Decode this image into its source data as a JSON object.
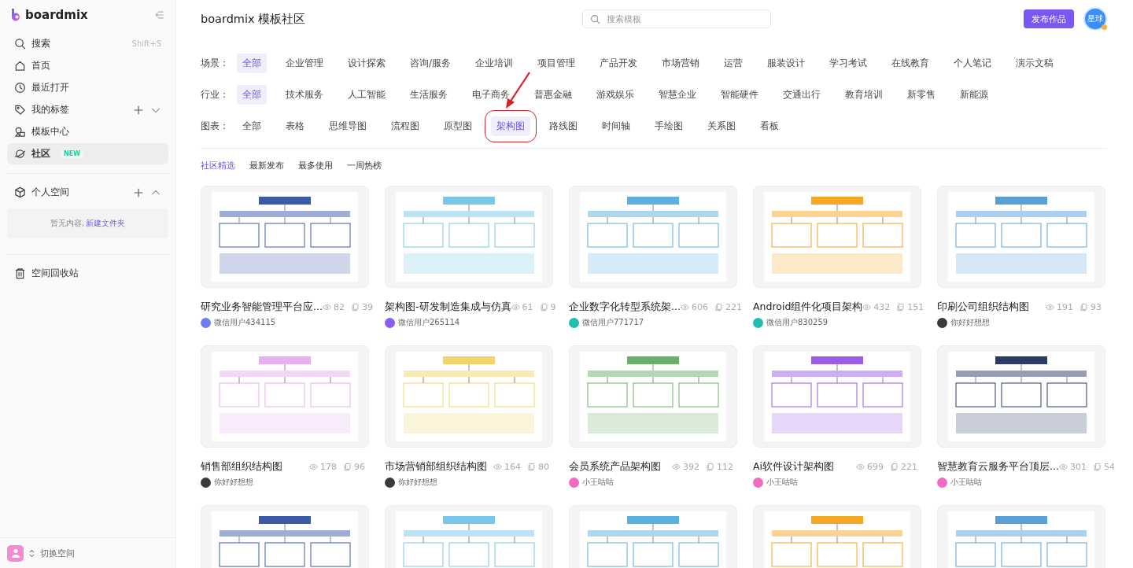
{
  "sidebar": {
    "logo": "boardmix",
    "nav": [
      {
        "kind": "search",
        "label": "搜索",
        "shortcut": "Shift+S",
        "selected": false
      },
      {
        "kind": "home",
        "label": "首页",
        "selected": false
      },
      {
        "kind": "recent",
        "label": "最近打开",
        "selected": false
      },
      {
        "kind": "tags",
        "label": "我的标签",
        "selected": false,
        "expanded": false
      },
      {
        "kind": "templates",
        "label": "模板中心",
        "selected": false
      },
      {
        "kind": "community",
        "label": "社区",
        "badge": "NEW",
        "selected": true
      }
    ],
    "workspace": {
      "label": "个人空间",
      "expanded": true,
      "empty_text": "暂无内容,",
      "link": "新建文件夹"
    },
    "trash": "空间回收站",
    "switch": "切换空间"
  },
  "header": {
    "title": "boardmix 模板社区",
    "search": {
      "placeholder": "搜索模板"
    },
    "publish": "发布作品",
    "avatar": "星球"
  },
  "filters": [
    {
      "label": "场景：",
      "options": [
        {
          "label": "全部",
          "selected": true
        },
        {
          "label": "企业管理",
          "selected": false
        },
        {
          "label": "设计探索",
          "selected": false
        },
        {
          "label": "咨询/服务",
          "selected": false
        },
        {
          "label": "企业培训",
          "selected": false
        },
        {
          "label": "项目管理",
          "selected": false
        },
        {
          "label": "产品开发",
          "selected": false
        },
        {
          "label": "市场营销",
          "selected": false
        },
        {
          "label": "运营",
          "selected": false
        },
        {
          "label": "服装设计",
          "selected": false
        },
        {
          "label": "学习考试",
          "selected": false
        },
        {
          "label": "在线教育",
          "selected": false
        },
        {
          "label": "个人笔记",
          "selected": false
        },
        {
          "label": "演示文稿",
          "selected": false
        }
      ]
    },
    {
      "label": "行业：",
      "options": [
        {
          "label": "全部",
          "selected": true
        },
        {
          "label": "技术服务",
          "selected": false
        },
        {
          "label": "人工智能",
          "selected": false
        },
        {
          "label": "生活服务",
          "selected": false
        },
        {
          "label": "电子商务",
          "selected": false
        },
        {
          "label": "普惠金融",
          "selected": false
        },
        {
          "label": "游戏娱乐",
          "selected": false
        },
        {
          "label": "智慧企业",
          "selected": false
        },
        {
          "label": "智能硬件",
          "selected": false
        },
        {
          "label": "交通出行",
          "selected": false
        },
        {
          "label": "教育培训",
          "selected": false
        },
        {
          "label": "新零售",
          "selected": false
        },
        {
          "label": "新能源",
          "selected": false
        }
      ]
    },
    {
      "label": "图表：",
      "options": [
        {
          "label": "全部",
          "selected": false
        },
        {
          "label": "表格",
          "selected": false
        },
        {
          "label": "思维导图",
          "selected": false
        },
        {
          "label": "流程图",
          "selected": false
        },
        {
          "label": "原型图",
          "selected": false
        },
        {
          "label": "架构图",
          "selected": true,
          "annotated": true
        },
        {
          "label": "路线图",
          "selected": false
        },
        {
          "label": "时间轴",
          "selected": false
        },
        {
          "label": "手绘图",
          "selected": false
        },
        {
          "label": "关系图",
          "selected": false
        },
        {
          "label": "看板",
          "selected": false
        }
      ]
    }
  ],
  "sort_tabs": [
    {
      "label": "社区精选",
      "selected": true
    },
    {
      "label": "最新发布",
      "selected": false
    },
    {
      "label": "最多使用",
      "selected": false
    },
    {
      "label": "一周热榜",
      "selected": false
    }
  ],
  "cards": [
    {
      "kind": "full",
      "title": "研究业务智能管理平台应...",
      "views": "82",
      "copies": "39",
      "author": "微信用户434115",
      "color": "#6f7cf0"
    },
    {
      "kind": "full",
      "title": "架构图-研发制造集成与仿真",
      "views": "61",
      "copies": "9",
      "author": "微信用户265114",
      "color": "#8a5cf0"
    },
    {
      "kind": "full",
      "title": "企业数字化转型系统架...",
      "views": "606",
      "copies": "221",
      "author": "微信用户771717",
      "color": "#1fbfb0"
    },
    {
      "kind": "full",
      "title": "Android组件化项目架构",
      "views": "432",
      "copies": "151",
      "author": "微信用户830259",
      "color": "#1fbfb0"
    },
    {
      "kind": "full",
      "title": "印刷公司组织结构图",
      "views": "191",
      "copies": "93",
      "author": "你好好想想",
      "color": "#3a3a3a"
    },
    {
      "kind": "full",
      "title": "销售部组织结构图",
      "views": "178",
      "copies": "96",
      "author": "你好好想想",
      "color": "#3a3a3a"
    },
    {
      "kind": "full",
      "title": "市场营销部组织结构图",
      "views": "164",
      "copies": "80",
      "author": "你好好想想",
      "color": "#3a3a3a"
    },
    {
      "kind": "full",
      "title": "会员系统产品架构图",
      "views": "392",
      "copies": "112",
      "author": "小王咕咕",
      "color": "#f06cc4"
    },
    {
      "kind": "full",
      "title": "Ai软件设计架构图",
      "views": "699",
      "copies": "221",
      "author": "小王咕咕",
      "color": "#f06cc4"
    },
    {
      "kind": "full",
      "title": "智慧教育云服务平台顶层...",
      "views": "301",
      "copies": "54",
      "author": "小王咕咕",
      "color": "#f06cc4"
    },
    {
      "kind": "cut"
    },
    {
      "kind": "cut"
    },
    {
      "kind": "cut"
    },
    {
      "kind": "cut"
    },
    {
      "kind": "cut"
    }
  ]
}
